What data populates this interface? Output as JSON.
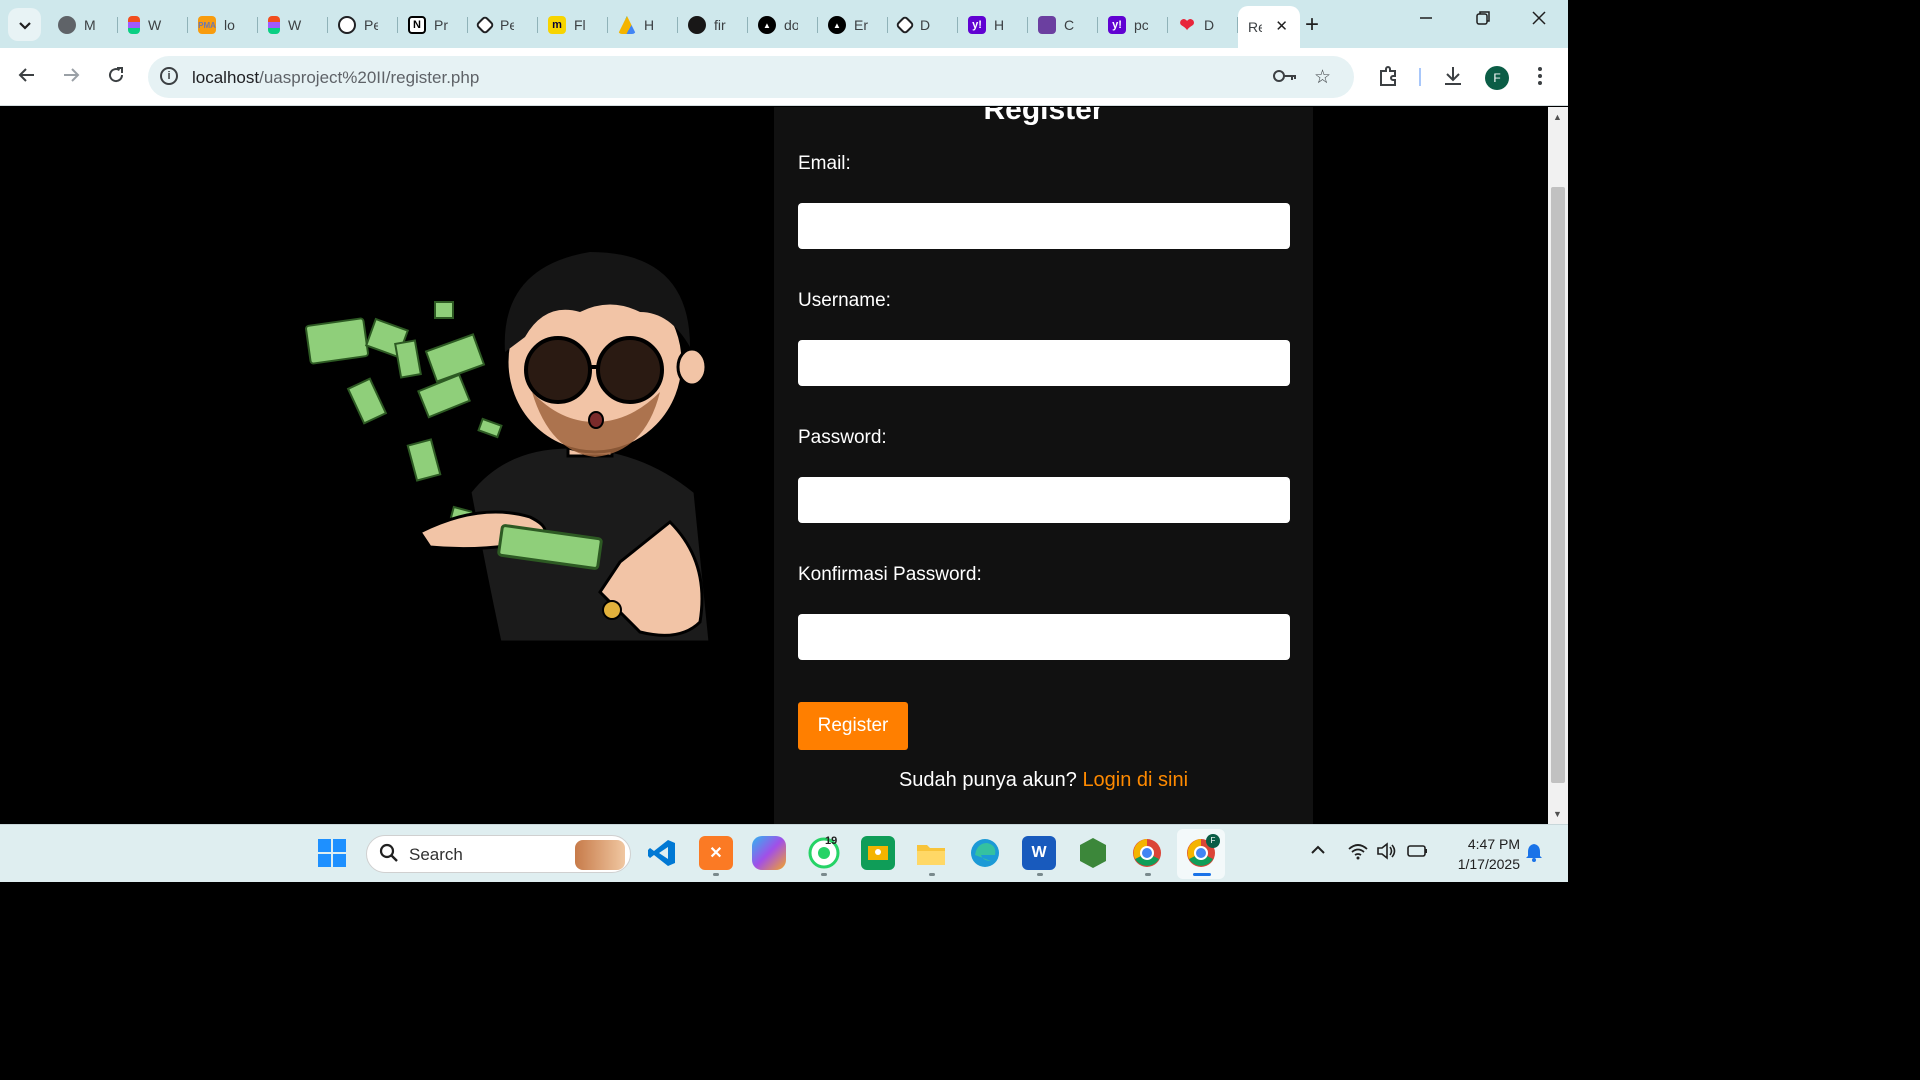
{
  "browser": {
    "tabs": [
      {
        "short": "M",
        "color": "#5f6368",
        "icon": "globe-icon"
      },
      {
        "short": "W",
        "color": "#f24e1e",
        "icon": "figma-icon"
      },
      {
        "short": "lo",
        "color": "#f89c0e",
        "icon": "phpmyadmin-icon"
      },
      {
        "short": "W",
        "color": "#f24e1e",
        "icon": "figma-icon"
      },
      {
        "short": "Pe",
        "color": "#202124",
        "icon": "openai-icon"
      },
      {
        "short": "Pr",
        "color": "#000000",
        "icon": "notion-icon"
      },
      {
        "short": "Pe",
        "color": "#202124",
        "icon": "codepen-icon"
      },
      {
        "short": "Fl",
        "color": "#f7d400",
        "icon": "miro-icon"
      },
      {
        "short": "H",
        "color": "#1fa463",
        "icon": "drive-icon"
      },
      {
        "short": "fir",
        "color": "#181717",
        "icon": "github-icon"
      },
      {
        "short": "do",
        "color": "#000000",
        "icon": "vercel-icon"
      },
      {
        "short": "Er",
        "color": "#000000",
        "icon": "vercel-icon"
      },
      {
        "short": "D",
        "color": "#202124",
        "icon": "codepen-icon"
      },
      {
        "short": "H",
        "color": "#6001d2",
        "icon": "yahoo-icon"
      },
      {
        "short": "C",
        "color": "#6b3fa0",
        "icon": "canva-icon"
      },
      {
        "short": "pc",
        "color": "#6001d2",
        "icon": "yahoo-icon"
      },
      {
        "short": "D",
        "color": "#e8253a",
        "icon": "heart-icon"
      }
    ],
    "active_tab": {
      "short": "Re"
    },
    "url_host": "localhost",
    "url_path": "/uasproject%20II/register.php",
    "profile_initial": "F"
  },
  "form": {
    "title": "Register",
    "email_label": "Email:",
    "username_label": "Username:",
    "password_label": "Password:",
    "confirm_label": "Konfirmasi Password:",
    "submit_label": "Register",
    "footer_text": "Sudah punya akun?",
    "footer_link": "Login di sini",
    "accent": "#ff7f00"
  },
  "taskbar": {
    "search_label": "Search",
    "whatsapp_badge": "19",
    "chrome_profile": "F",
    "time": "4:47 PM",
    "date": "1/17/2025"
  }
}
